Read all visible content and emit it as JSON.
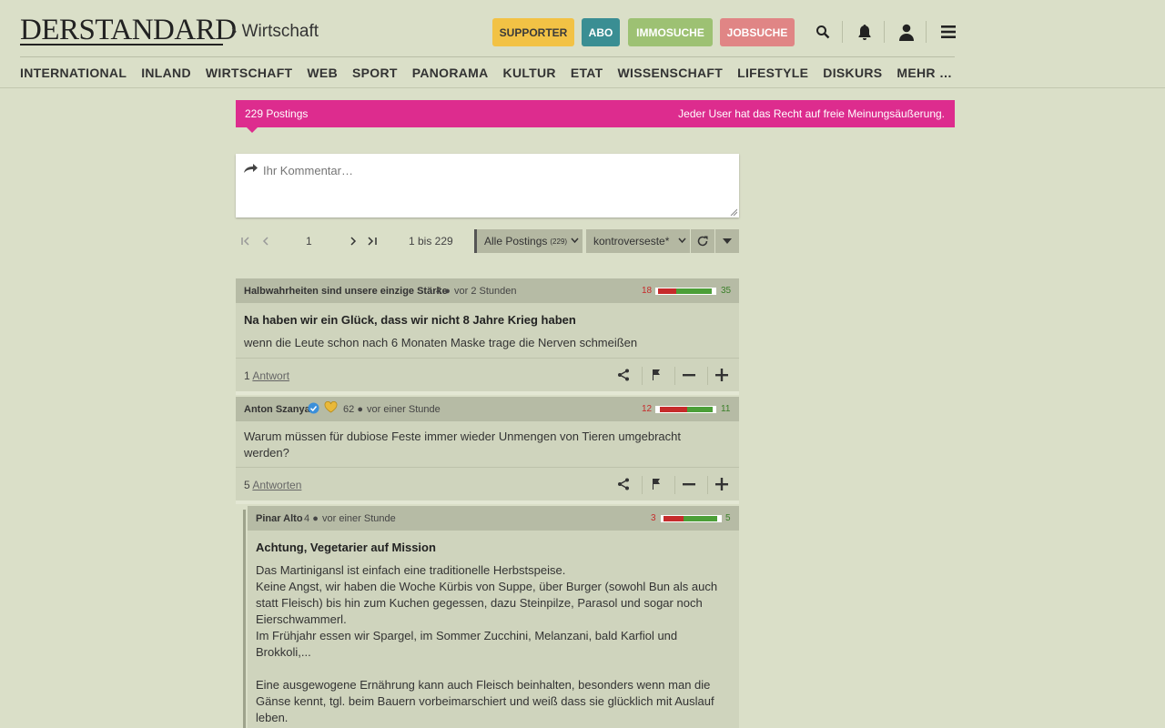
{
  "header": {
    "logo": "DERSTANDARD",
    "section": "› Wirtschaft",
    "buttons": [
      {
        "label": "SUPPORTER",
        "color": "#f2c245"
      },
      {
        "label": "ABO",
        "color": "#3a8e93"
      },
      {
        "label": "IMMOSUCHE",
        "color": "#9dc173"
      },
      {
        "label": "JOBSUCHE",
        "color": "#e08585"
      }
    ],
    "icons": [
      "search-icon",
      "bell-icon",
      "user-icon",
      "menu-icon"
    ]
  },
  "nav": [
    "INTERNATIONAL",
    "INLAND",
    "WIRTSCHAFT",
    "WEB",
    "SPORT",
    "PANORAMA",
    "KULTUR",
    "ETAT",
    "WISSENSCHAFT",
    "LIFESTYLE",
    "DISKURS",
    "MEHR …"
  ],
  "forum": {
    "count": "229 Postings",
    "rule": "Jeder User hat das Recht auf freie Meinungsäußerung.",
    "compose_placeholder": "Ihr Kommentar…",
    "pager": {
      "page": "1",
      "range": "1 bis 229"
    },
    "filter": {
      "label": "Alle Postings",
      "count": "(229)"
    },
    "sort": "kontroverseste*"
  },
  "posts": [
    {
      "author": "Halbwahrheiten sind unsere einzige Stärke",
      "followers": "4",
      "time": "vor 2 Stunden",
      "neg": "18",
      "pos": "35",
      "neg_share": 0.34,
      "title": "Na haben wir ein Glück, dass wir nicht 8 Jahre Krieg haben",
      "body": "wenn die Leute schon nach 6 Monaten Maske trage die Nerven schmeißen",
      "replies_count": "1",
      "replies_label": "Antwort"
    },
    {
      "author": "Anton Szanya",
      "followers": "62",
      "time": "vor einer Stunde",
      "neg": "12",
      "pos": "11",
      "neg_share": 0.52,
      "title": "",
      "body": "Warum müssen für dubiose Feste immer wieder Unmengen von Tieren umgebracht werden?",
      "replies_count": "5",
      "replies_label": "Antworten"
    },
    {
      "author": "Pinar Alto",
      "followers": "4",
      "time": "vor einer Stunde",
      "neg": "3",
      "pos": "5",
      "neg_share": 0.375,
      "title": "Achtung, Vegetarier auf Mission",
      "body": "Das Martinigansl ist einfach eine traditionelle Herbstspeise.\nKeine Angst, wir haben die Woche Kürbis von Suppe, über Burger (sowohl Bun als auch statt Fleisch) bis hin zum Kuchen gegessen, dazu Steinpilze, Parasol und sogar noch Eierschwammerl.\nIm Frühjahr essen wir Spargel, im Sommer Zucchini, Melanzani, bald Karfiol und Brokkoli,...\n\nEine ausgewogene Ernährung kann auch Fleisch beinhalten, besonders wenn man die Gänse kennt, tgl. beim Bauern vorbeimarschiert und weiß dass sie glücklich mit Auslauf leben."
    }
  ]
}
